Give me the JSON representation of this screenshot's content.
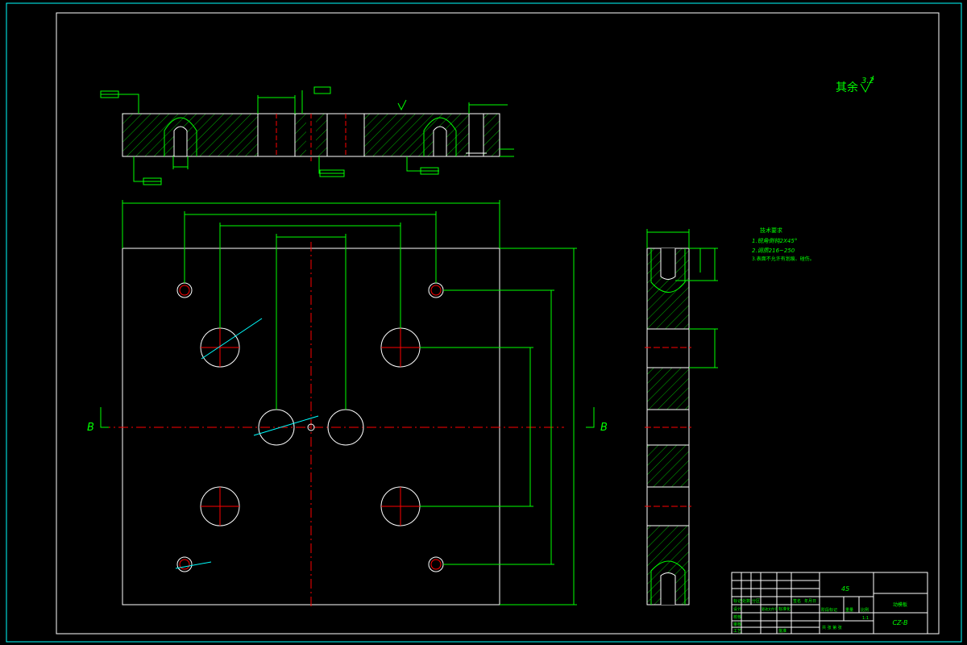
{
  "colors": {
    "background": "#000000",
    "border": "#00ffff",
    "outline": "#ffffff",
    "dimension": "#00ff00",
    "center": "#ff0000",
    "hatch": "#00ff00",
    "title_text": "#00ff00",
    "title_lines": "#ffffff"
  },
  "labels": {
    "surface_rest": "其余",
    "surface_rest_value": "3.2",
    "section_mark_left": "B",
    "section_mark_right": "B",
    "tech_req_title": "技术要求",
    "tech_req_1": "1.锐角倒钝2X45°",
    "tech_req_2": "2.调质216~250",
    "tech_req_3": "3.表面不允许有划痕、碰伤。"
  },
  "title_block": {
    "material": "45",
    "name": "动模板",
    "drawing_no": "CZ-B",
    "row_1": "标记",
    "row_2": "设计",
    "row_3": "校核",
    "row_4": "审核",
    "row_5": "工艺",
    "col_a": "处数",
    "col_b": "分区",
    "col_c": "更改文件号",
    "col_d": "签名",
    "col_e": "年月日",
    "col_f": "标准化",
    "stage": "阶段标记",
    "weight": "重量",
    "scale": "比例",
    "scale_value": "1:1",
    "sheet_info": "共 张 第 张",
    "approve": "批准"
  }
}
